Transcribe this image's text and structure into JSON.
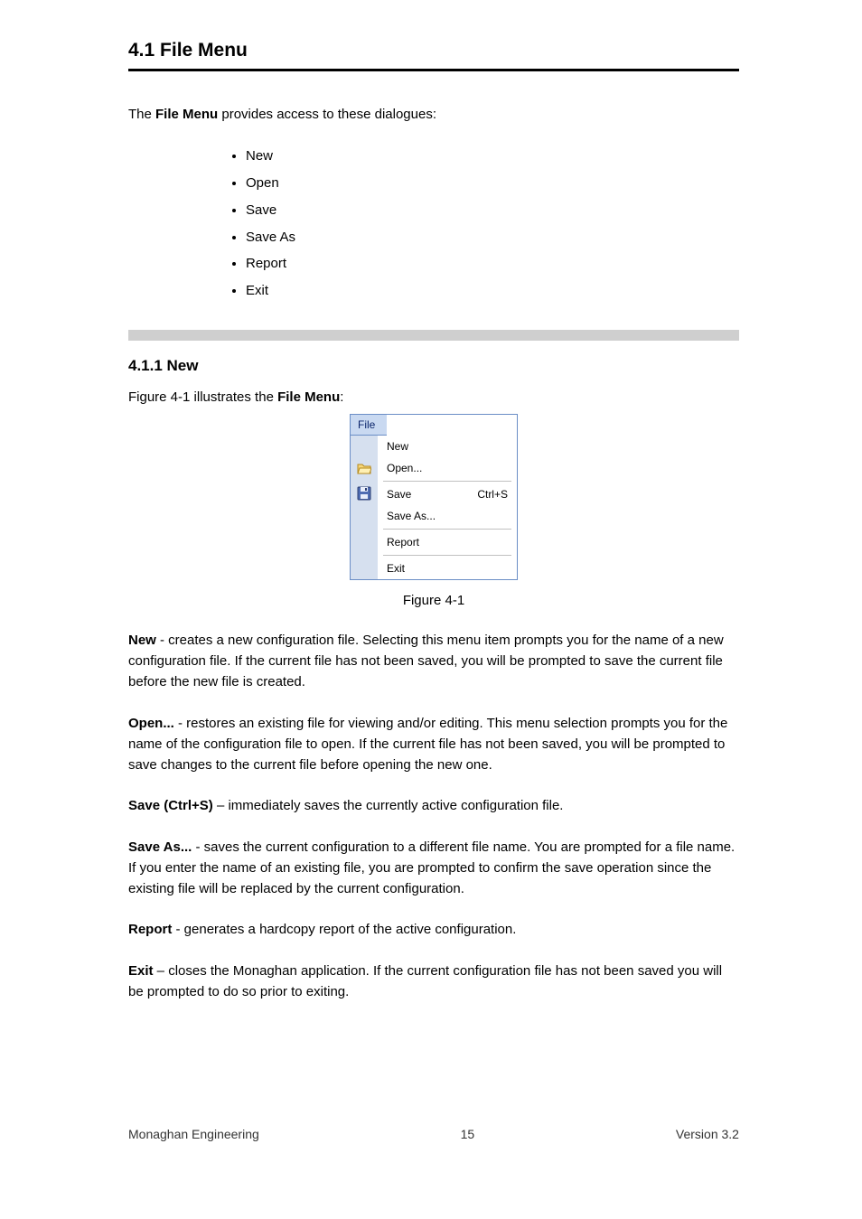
{
  "section": {
    "number": "4.1",
    "title": "File Menu ",
    "intro_prefix": "The ",
    "intro_bold": "File Menu",
    "intro_suffix": " provides access to these dialogues: ",
    "bullets": [
      "New",
      "Open",
      "Save",
      "Save As",
      "Report",
      "Exit"
    ]
  },
  "sub": {
    "heading": "4.1.1 New ",
    "fig_label_prefix": "Figure 4-1 illustrates the ",
    "fig_label_bold": "File Menu",
    "fig_label_suffix": ": ",
    "fig_num": "Figure 4-1 "
  },
  "paras": {
    "p1_lead": "New",
    "p1_body": " - creates a new configuration file.  Selecting this menu item prompts you for the name of a new configuration file.  If the current file has not been saved, you will be prompted to save the current file before the new file is created. ",
    "p2_lead": "Open...",
    "p2_body": " - restores an existing file for viewing and/or editing.  This menu selection prompts you for the name of the configuration file to open.  If the current file has not been saved, you will be prompted to save changes to the current file before opening the new one. ",
    "p3_lead": "Save (Ctrl+S)",
    "p3_body": " – immediately saves the currently active configuration file. ",
    "p4_lead": "Save As...",
    "p4_body": " - saves the current configuration to a different file name.  You are prompted for a file name.  If you enter the name of an existing file, you are prompted to confirm the save operation since the existing file will be replaced by the current configuration. ",
    "p5_lead": "Report",
    "p5_body": " - generates a hardcopy report of the active configuration. ",
    "p6_lead": "Exit",
    "p6_body": " – closes the Monaghan application. If the current configuration file has not been saved you will be prompted to do so prior to exiting. "
  },
  "menu_graphic": {
    "header": "File",
    "rows": [
      {
        "label": "New",
        "shortcut": "",
        "icon": null,
        "sep_before": false
      },
      {
        "label": "Open...",
        "shortcut": "",
        "icon": "folder",
        "sep_before": false
      },
      {
        "label": "Save",
        "shortcut": "Ctrl+S",
        "icon": "disk",
        "sep_before": true
      },
      {
        "label": "Save As...",
        "shortcut": "",
        "icon": null,
        "sep_before": false
      },
      {
        "label": "Report",
        "shortcut": "",
        "icon": null,
        "sep_before": true
      },
      {
        "label": "Exit",
        "shortcut": "",
        "icon": null,
        "sep_before": true
      }
    ]
  },
  "footer": {
    "left": "Monaghan Engineering ",
    "center": "15",
    "right": "Version 3.2 "
  }
}
